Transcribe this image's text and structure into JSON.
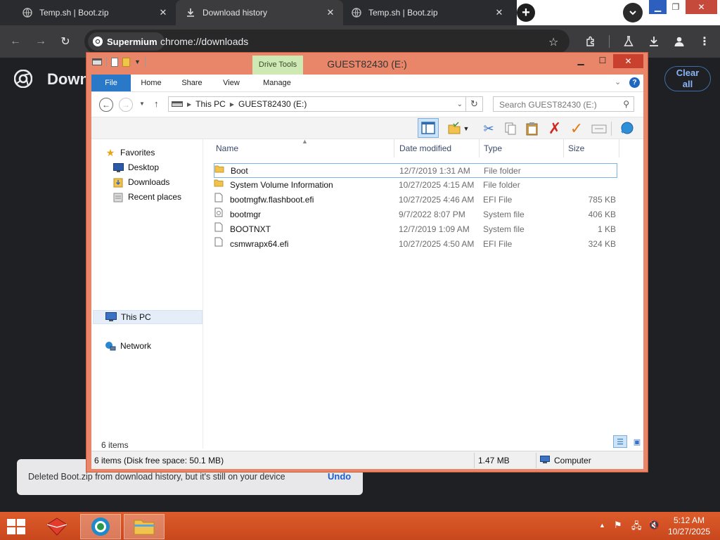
{
  "browser": {
    "tabs": [
      {
        "title": "Temp.sh | Boot.zip",
        "icon": "globe-icon"
      },
      {
        "title": "Download history",
        "icon": "download-icon"
      },
      {
        "title": "Temp.sh | Boot.zip",
        "icon": "globe-icon"
      }
    ],
    "chip_label": "Supermium",
    "url": "chrome://downloads",
    "page_title": "Downl",
    "clear_all_line1": "Clear",
    "clear_all_line2": "all",
    "colors": {
      "tabbar": "#2a2b2e",
      "toolbar": "#3c3c3f",
      "accent": "#8ab4f8"
    }
  },
  "toast": {
    "message": "Deleted Boot.zip from download history, but it's still on your device",
    "undo_label": "Undo"
  },
  "explorer": {
    "title": "GUEST82430 (E:)",
    "context_tab": "Drive Tools",
    "ribbon_tabs": [
      "File",
      "Home",
      "Share",
      "View",
      "Manage"
    ],
    "breadcrumb": [
      "This PC",
      "GUEST82430 (E:)"
    ],
    "search_placeholder": "Search GUEST82430 (E:)",
    "nav": {
      "favorites": "Favorites",
      "favorites_items": [
        "Desktop",
        "Downloads",
        "Recent places"
      ],
      "this_pc": "This PC",
      "network": "Network"
    },
    "columns": [
      "Name",
      "Date modified",
      "Type",
      "Size"
    ],
    "files": [
      {
        "name": "Boot",
        "date": "12/7/2019 1:31 AM",
        "type": "File folder",
        "size": "",
        "kind": "folder"
      },
      {
        "name": "System Volume Information",
        "date": "10/27/2025 4:15 AM",
        "type": "File folder",
        "size": "",
        "kind": "folder"
      },
      {
        "name": "bootmgfw.flashboot.efi",
        "date": "10/27/2025 4:46 AM",
        "type": "EFI File",
        "size": "785 KB",
        "kind": "file"
      },
      {
        "name": "bootmgr",
        "date": "9/7/2022 8:07 PM",
        "type": "System file",
        "size": "406 KB",
        "kind": "sysfile"
      },
      {
        "name": "BOOTNXT",
        "date": "12/7/2019 1:09 AM",
        "type": "System file",
        "size": "1 KB",
        "kind": "file"
      },
      {
        "name": "csmwrapx64.efi",
        "date": "10/27/2025 4:50 AM",
        "type": "EFI File",
        "size": "324 KB",
        "kind": "file"
      }
    ],
    "item_count": "6 items",
    "status": {
      "left": "6 items (Disk free space: 50.1 MB)",
      "size": "1.47 MB",
      "location": "Computer"
    },
    "colors": {
      "frame": "#e9866a",
      "file_tab": "#2a78c8",
      "drive_tools": "#cfe9b5"
    }
  },
  "taskbar": {
    "time": "5:12 AM",
    "date": "10/27/2025",
    "color": "#d5522a"
  }
}
